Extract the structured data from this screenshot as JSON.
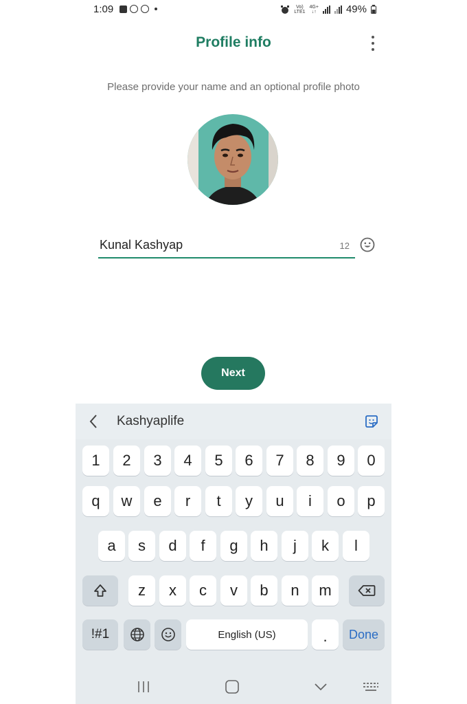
{
  "status_bar": {
    "time": "1:09",
    "network_top": "Vo)",
    "network_bottom": "LTE1",
    "net_type_top": "4G+",
    "net_type_bottom": "↓↑",
    "battery": "49%"
  },
  "header": {
    "title": "Profile info",
    "subtitle": "Please provide your name and an optional profile photo"
  },
  "profile": {
    "name_value": "Kunal Kashyap",
    "remaining_chars": "12"
  },
  "next_button": {
    "label": "Next"
  },
  "keyboard": {
    "suggestion": "Kashyaplife",
    "row_numbers": [
      "1",
      "2",
      "3",
      "4",
      "5",
      "6",
      "7",
      "8",
      "9",
      "0"
    ],
    "row_1": [
      "q",
      "w",
      "e",
      "r",
      "t",
      "y",
      "u",
      "i",
      "o",
      "p"
    ],
    "row_2": [
      "a",
      "s",
      "d",
      "f",
      "g",
      "h",
      "j",
      "k",
      "l"
    ],
    "row_3": [
      "z",
      "x",
      "c",
      "v",
      "b",
      "n",
      "m"
    ],
    "symbols_label": "!#1",
    "space_label": "English (US)",
    "period_label": ".",
    "done_label": "Done"
  },
  "colors": {
    "accent": "#1f7d62",
    "button": "#25785f",
    "done_text": "#2a6cc4",
    "keyboard_bg": "#e6ebee"
  },
  "icons": [
    "alarm-icon",
    "menu-icon",
    "emoji-icon",
    "back-icon",
    "sticker-icon",
    "shift-icon",
    "backspace-icon",
    "globe-icon",
    "recent-apps-icon",
    "home-icon",
    "back-nav-icon",
    "keyboard-switch-icon"
  ]
}
